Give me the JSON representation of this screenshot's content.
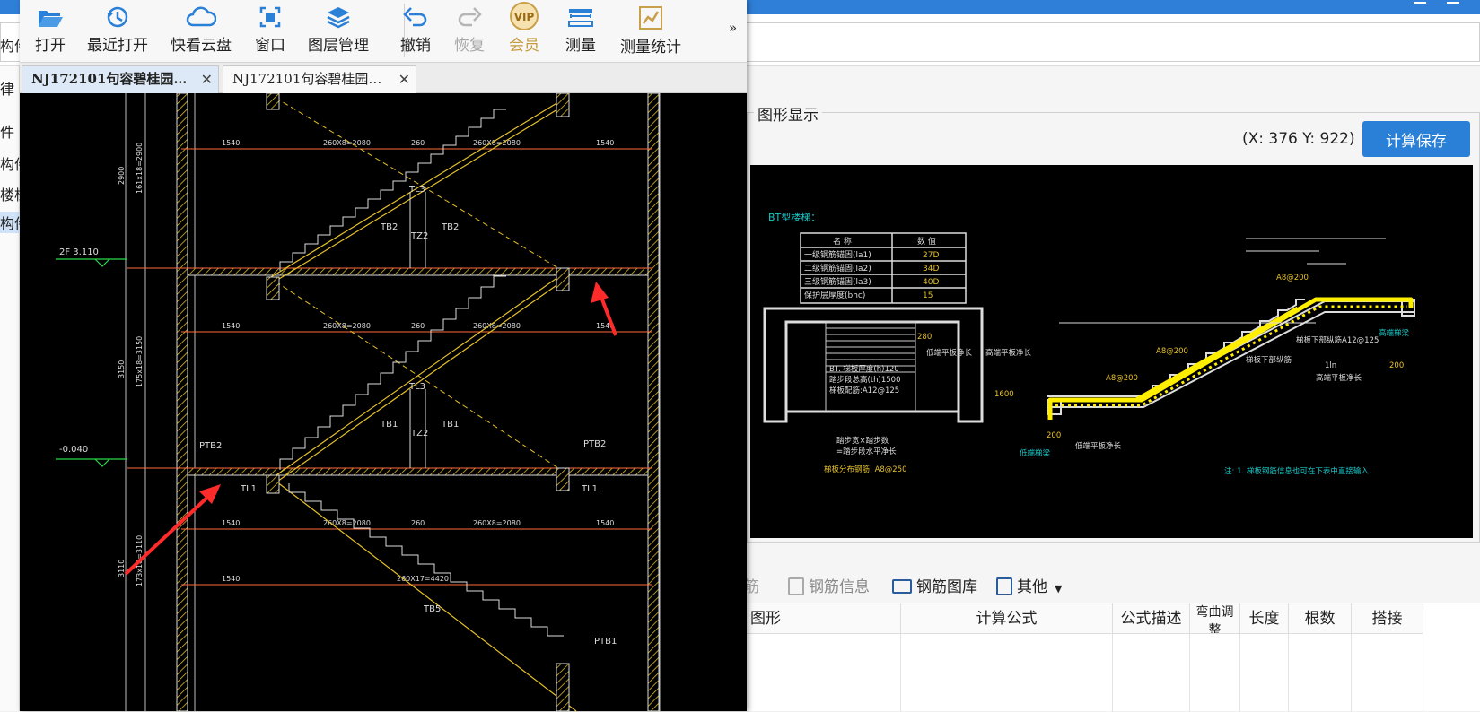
{
  "toolbar": {
    "open": "打开",
    "recent": "最近打开",
    "cloud": "快看云盘",
    "window": "窗口",
    "layers": "图层管理",
    "undo": "撤销",
    "redo": "恢复",
    "vip_badge": "VIP",
    "member": "会员",
    "measure": "测量",
    "measure_stats": "测量统计",
    "more": "»"
  },
  "tabs": [
    {
      "label": "NJ172101句容碧桂园…",
      "close": "✕"
    },
    {
      "label": "NJ172101句容碧桂园…",
      "close": "✕"
    }
  ],
  "cad": {
    "section_dims": [
      "1540",
      "260X8=2080",
      "260",
      "260X8=2080",
      "1540"
    ],
    "bottom_dims": [
      "1540",
      "260X17=4420"
    ],
    "labels": {
      "tl3": "TL3",
      "tz2": "TZ2",
      "tb2": "TB2",
      "tb1": "TB1",
      "tb5": "TB5",
      "ptb2": "PTB2",
      "ptb1": "PTB1",
      "tl1": "TL1",
      "elev_2f": "2F 3.110",
      "elev_0": "-0.040",
      "vdim_2900": "2900",
      "vdim_2900b": "161x18=2900",
      "vdim_3150": "3150",
      "vdim_3150b": "175x18=3150",
      "vdim_3110": "3110",
      "vdim_3110b": "173x18=3110"
    },
    "annotation_color": "#ff2a2a"
  },
  "bg_app": {
    "rail": [
      "构件",
      "律",
      "件",
      "构件",
      "楼梯",
      "构件"
    ],
    "graph_title": "图形显示",
    "coords": "(X: 376 Y: 922)",
    "calc_save": "计算保存",
    "bottom_toolbar": {
      "peijin": "配筋",
      "rebar_info": "钢筋信息",
      "rebar_lib": "钢筋图库",
      "other": "其他"
    },
    "grid_headers": [
      "图形",
      "计算公式",
      "公式描述",
      "弯曲调整",
      "长度",
      "根数",
      "搭接"
    ]
  },
  "rebar_diagram": {
    "title": "BT型楼梯：",
    "table_headers": [
      "名  称",
      "数  值"
    ],
    "table_rows": [
      [
        "一级钢筋锚固(la1)",
        "27D"
      ],
      [
        "二级钢筋锚固(la2)",
        "34D"
      ],
      [
        "三级钢筋锚固(la3)",
        "40D"
      ],
      [
        "保护层厚度(bhc)",
        "15"
      ]
    ],
    "plan_labels": [
      "BT. 梯板厚度(h)120",
      "踏步段总高(th)1500",
      "梯板配筋:A12@125",
      "踏步宽×踏步数",
      "=踏步段水平净长",
      "梯板分布钢筋: A8@250",
      "低端平板净长",
      "高端平板净长",
      "280",
      "1600"
    ],
    "section_labels": [
      "A8@200",
      "A8@200",
      "A8@200",
      "梯板下部纵筋A12@125",
      "梯板下部纵筋",
      "高端梯梁",
      "低端梯梁",
      "高端平板净长",
      "低端平板净长",
      "1ln",
      "200",
      "200"
    ],
    "note": "注: 1. 梯板钢筋信息也可在下表中直接输入."
  }
}
